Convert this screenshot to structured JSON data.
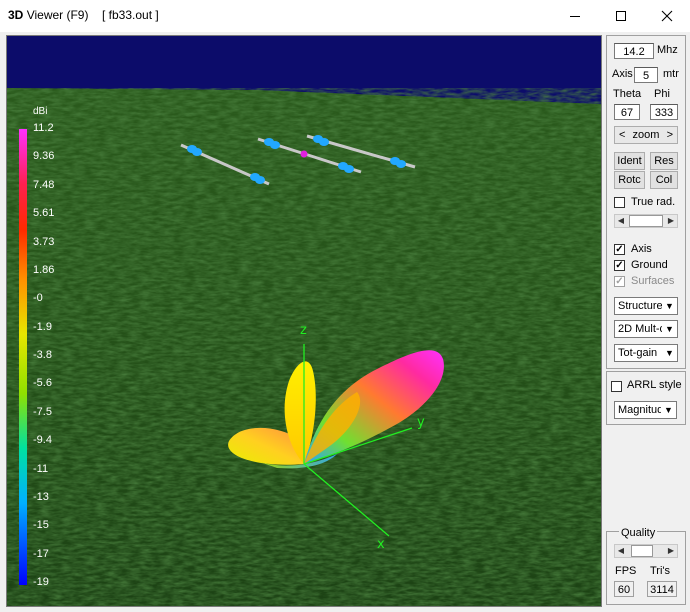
{
  "window": {
    "title_bold": "3D",
    "title": "Viewer (F9)",
    "file": "[  fb33.out ]"
  },
  "legend": {
    "unit": "dBi",
    "ticks": [
      "11.2",
      "9.36",
      "7.48",
      "5.61",
      "3.73",
      "1.86",
      "-0",
      "-1.9",
      "-3.8",
      "-5.6",
      "-7.5",
      "-9.4",
      "-11",
      "-13",
      "-15",
      "-17",
      "-19"
    ]
  },
  "axes": {
    "x": "x",
    "y": "y",
    "z": "z"
  },
  "panel": {
    "frequency": "14.2",
    "frequency_unit": "Mhz",
    "axis_label": "Axis",
    "axis_value": "5",
    "axis_unit": "mtr",
    "theta_label": "Theta",
    "phi_label": "Phi",
    "theta_value": "67",
    "phi_value": "333",
    "zoom_label": "zoom",
    "zoom_left": "<",
    "zoom_right": ">",
    "ident_label": "Ident",
    "res_label": "Res",
    "rotc_label": "Rotc",
    "col_label": "Col",
    "true_rad_label": "True rad.",
    "true_rad_checked": false,
    "axis_check_label": "Axis",
    "axis_checked": true,
    "ground_label": "Ground",
    "ground_checked": true,
    "surfaces_label": "Surfaces",
    "surfaces_checked": true,
    "structure_select": "Structure",
    "mult_select": "2D Mult-c",
    "gain_select": "Tot-gain",
    "arrl_label": "ARRL style",
    "arrl_checked": false,
    "magnitude_select": "Magnitud",
    "quality_label": "Quality",
    "fps_label": "FPS",
    "tris_label": "Tri's",
    "fps_value": "60",
    "tris_value": "3114"
  }
}
